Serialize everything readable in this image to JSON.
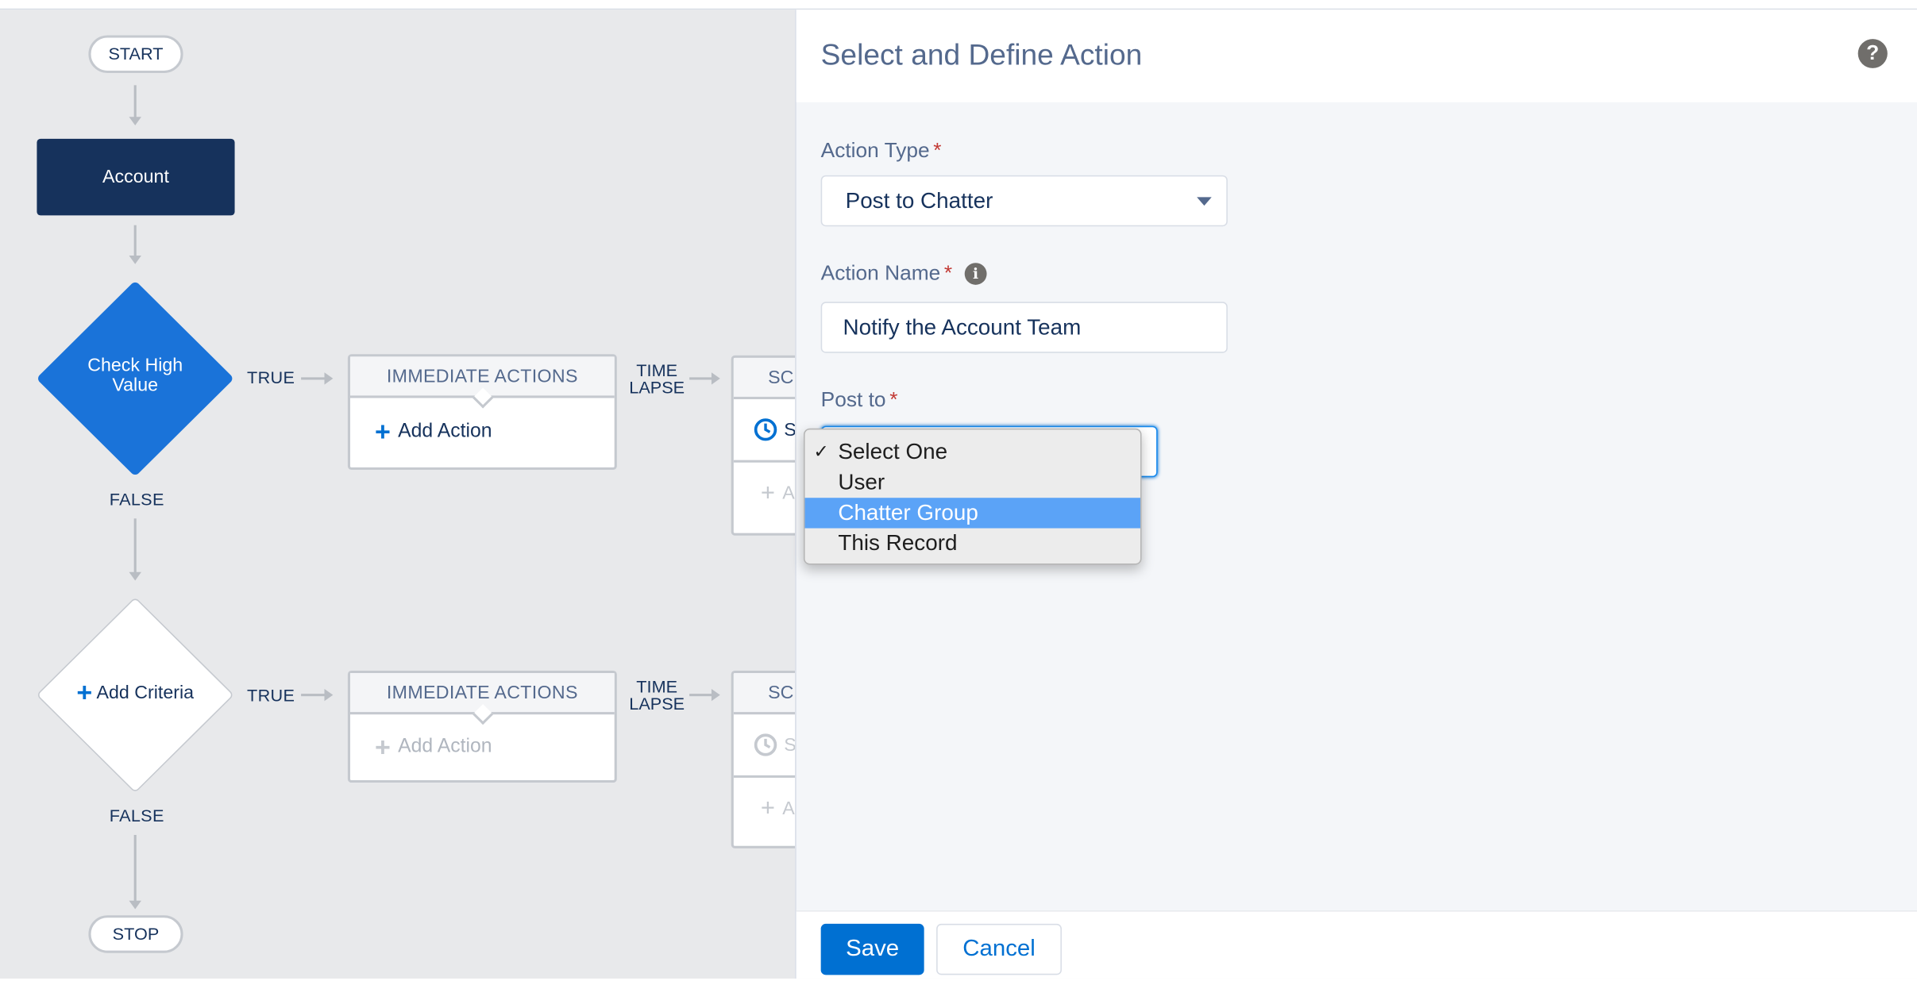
{
  "canvas": {
    "start_label": "START",
    "stop_label": "STOP",
    "object_node": "Account",
    "criteria_1": "Check High Value",
    "criteria_2_label": "Add Criteria",
    "true_label": "TRUE",
    "false_label": "FALSE",
    "immediate_actions_header": "IMMEDIATE ACTIONS",
    "add_action_label": "Add Action",
    "time_lapse_line1": "TIME",
    "time_lapse_line2": "LAPSE",
    "scheduled_header_partial": "SCI",
    "scheduled_row_partial": "S",
    "scheduled_add_partial": "A"
  },
  "panel": {
    "title": "Select and Define Action",
    "help_icon": "question-circle-icon",
    "action_type_label": "Action Type",
    "action_type_value": "Post to Chatter",
    "action_name_label": "Action Name",
    "action_name_value": "Notify the Account Team",
    "post_to_label": "Post to",
    "required_marker": "*",
    "save_label": "Save",
    "cancel_label": "Cancel"
  },
  "dropdown": {
    "options": [
      "Select One",
      "User",
      "Chatter Group",
      "This Record"
    ],
    "selected": "Select One",
    "highlighted": "Chatter Group",
    "check_mark": "✓"
  },
  "colors": {
    "dark_navy": "#16325c",
    "brand_blue": "#0070d2",
    "diamond_blue": "#1a73d9",
    "highlight": "#5ba3f7"
  }
}
